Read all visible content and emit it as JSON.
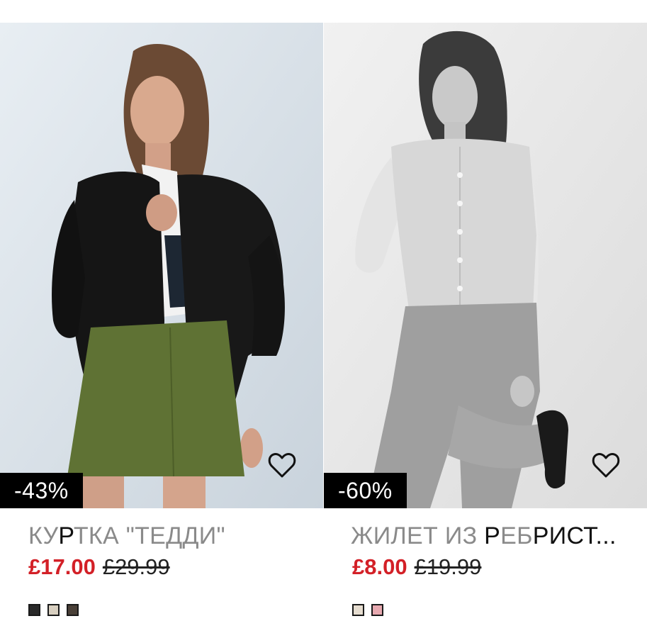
{
  "products": [
    {
      "discount": "-43%",
      "name_parts": [
        "КУ",
        "Р",
        "ТКА \"ТЕДДИ\""
      ],
      "sale_price": "£17.00",
      "original_price": "£29.99",
      "swatches": [
        "#2a2a2a",
        "#d8cfc0",
        "#4a4038"
      ],
      "favorite_icon": "heart-outline-icon",
      "image_alt": "model-in-black-teddy-jacket"
    },
    {
      "discount": "-60%",
      "name_parts": [
        "ЖИЛЕТ ИЗ ",
        "Р",
        "ЕБ",
        "Р",
        "ИСТ..."
      ],
      "sale_price": "£8.00",
      "original_price": "£19.99",
      "swatches": [
        "#e6ddd0",
        "#e7a9b0"
      ],
      "favorite_icon": "heart-outline-icon",
      "image_alt": "model-in-ribbed-knit-vest-monochrome"
    }
  ],
  "colors": {
    "sale_red": "#d32027",
    "name_grey": "#8a8a8a",
    "badge_bg": "#000000"
  }
}
